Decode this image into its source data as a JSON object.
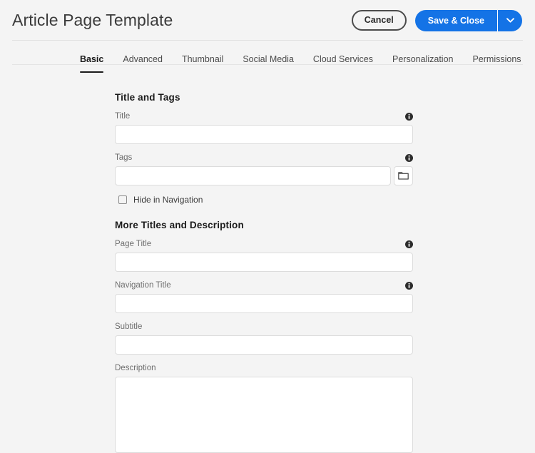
{
  "header": {
    "title": "Article Page Template",
    "cancel_label": "Cancel",
    "save_label": "Save & Close",
    "save_more_icon": "chevron-down-icon"
  },
  "tabs": [
    {
      "label": "Basic",
      "active": true
    },
    {
      "label": "Advanced",
      "active": false
    },
    {
      "label": "Thumbnail",
      "active": false
    },
    {
      "label": "Social Media",
      "active": false
    },
    {
      "label": "Cloud Services",
      "active": false
    },
    {
      "label": "Personalization",
      "active": false
    },
    {
      "label": "Permissions",
      "active": false
    }
  ],
  "sections": [
    {
      "heading": "Title and Tags",
      "fields": [
        {
          "label": "Title",
          "value": "",
          "placeholder": "",
          "info": true,
          "type": "text"
        },
        {
          "label": "Tags",
          "value": "",
          "placeholder": "",
          "info": true,
          "type": "text-browse",
          "browse_icon": "folder-icon"
        }
      ],
      "checkbox": {
        "label": "Hide in Navigation",
        "checked": false
      }
    },
    {
      "heading": "More Titles and Description",
      "fields": [
        {
          "label": "Page Title",
          "value": "",
          "placeholder": "",
          "info": true,
          "type": "text"
        },
        {
          "label": "Navigation Title",
          "value": "",
          "placeholder": "",
          "info": true,
          "type": "text"
        },
        {
          "label": "Subtitle",
          "value": "",
          "placeholder": "",
          "info": false,
          "type": "text"
        },
        {
          "label": "Description",
          "value": "",
          "placeholder": "",
          "info": false,
          "type": "textarea"
        }
      ]
    }
  ],
  "colors": {
    "accent": "#1473e6",
    "background": "#f4f4f4",
    "field_background": "#ffffff",
    "field_border": "#dcdcdc",
    "text_primary": "#2c2c2c",
    "label_text": "#6e6e6e"
  }
}
